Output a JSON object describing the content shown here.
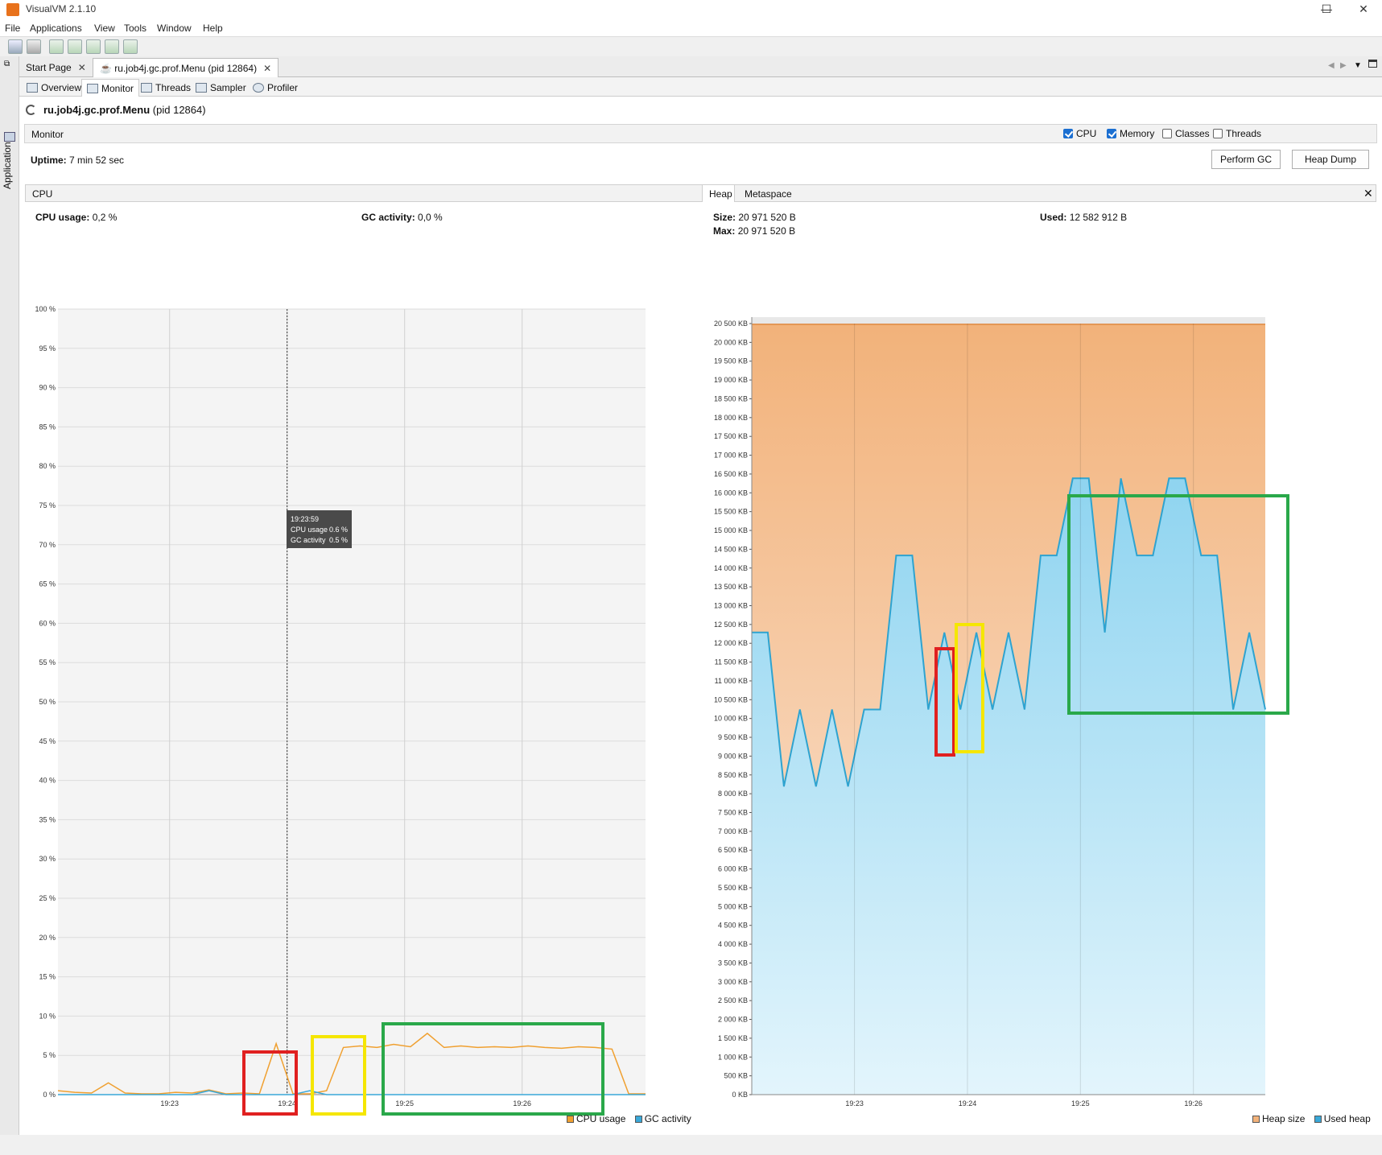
{
  "window": {
    "title": "VisualVM 2.1.10",
    "minimize": "—",
    "maximize": "☐",
    "close": "✕"
  },
  "menu": [
    "File",
    "Applications",
    "View",
    "Tools",
    "Window",
    "Help"
  ],
  "sidebar": {
    "label": "Applications"
  },
  "doc_tabs": [
    {
      "label": "Start Page"
    },
    {
      "label": "ru.job4j.gc.prof.Menu (pid 12864)"
    }
  ],
  "sub_tabs": [
    "Overview",
    "Monitor",
    "Threads",
    "Sampler",
    "Profiler"
  ],
  "process": {
    "name": "ru.job4j.gc.prof.Menu",
    "pid": "(pid 12864)"
  },
  "monitor": {
    "label": "Monitor",
    "checks": [
      {
        "label": "CPU",
        "checked": true
      },
      {
        "label": "Memory",
        "checked": true
      },
      {
        "label": "Classes",
        "checked": false
      },
      {
        "label": "Threads",
        "checked": false
      }
    ],
    "uptime_label": "Uptime:",
    "uptime_value": "7 min 52 sec",
    "perform_gc": "Perform GC",
    "heap_dump": "Heap Dump"
  },
  "cpu_panel": {
    "tab": "CPU",
    "cpu_usage_label": "CPU usage:",
    "cpu_usage_value": "0,2 %",
    "gc_activity_label": "GC activity:",
    "gc_activity_value": "0,0 %",
    "legend": [
      "CPU usage",
      "GC activity"
    ],
    "tooltip": {
      "time": "19:23:59",
      "cpu_label": "CPU usage",
      "cpu_value": "0.6 %",
      "gc_label": "GC activity",
      "gc_value": "0.5 %"
    }
  },
  "heap_panel": {
    "tabs": [
      "Heap",
      "Metaspace"
    ],
    "size_label": "Size:",
    "size_value": "20 971 520 B",
    "max_label": "Max:",
    "max_value": "20 971 520 B",
    "used_label": "Used:",
    "used_value": "12 582 912 B",
    "legend": [
      "Heap size",
      "Used heap"
    ]
  },
  "colors": {
    "cpu": "#f0a030",
    "gc": "#3aa8d8",
    "heap_size": "#f2b27a",
    "used_heap": "#8fd4f0",
    "used_line": "#2ea3d0",
    "red": "#e02020",
    "yellow": "#f5e600",
    "green": "#2aa84a"
  },
  "chart_data": [
    {
      "type": "line",
      "title": "CPU",
      "x": [
        "19:23",
        "19:24",
        "19:25",
        "19:26"
      ],
      "ylim": [
        0,
        100
      ],
      "yticks": [
        "0 %",
        "5 %",
        "10 %",
        "15 %",
        "20 %",
        "25 %",
        "30 %",
        "35 %",
        "40 %",
        "45 %",
        "50 %",
        "55 %",
        "60 %",
        "65 %",
        "70 %",
        "75 %",
        "80 %",
        "85 %",
        "90 %",
        "95 %",
        "100 %"
      ],
      "series": [
        {
          "name": "CPU usage",
          "values": [
            0.5,
            0.3,
            0.2,
            1.5,
            0.2,
            0.1,
            0.1,
            0.3,
            0.2,
            0.6,
            0.1,
            0.2,
            0.1,
            6.5,
            0.1,
            0.1,
            0.5,
            6.0,
            6.2,
            6.0,
            6.4,
            6.1,
            7.8,
            6.0,
            6.2,
            6.0,
            6.1,
            6.0,
            6.2,
            6.0,
            5.9,
            6.1,
            6.0,
            5.8,
            0.1,
            0.1
          ]
        },
        {
          "name": "GC activity",
          "values": [
            0,
            0,
            0,
            0,
            0,
            0,
            0,
            0,
            0,
            0.5,
            0,
            0,
            0,
            0,
            0,
            0.5,
            0,
            0,
            0,
            0,
            0,
            0,
            0,
            0,
            0,
            0,
            0,
            0,
            0,
            0,
            0,
            0,
            0,
            0,
            0,
            0
          ]
        }
      ]
    },
    {
      "type": "area",
      "title": "Heap",
      "x": [
        "19:23",
        "19:24",
        "19:25",
        "19:26"
      ],
      "ylim": [
        0,
        20500
      ],
      "yticks": [
        "0 KB",
        "500 KB",
        "1 000 KB",
        "1 500 KB",
        "2 000 KB",
        "2 500 KB",
        "3 000 KB",
        "3 500 KB",
        "4 000 KB",
        "4 500 KB",
        "5 000 KB",
        "5 500 KB",
        "6 000 KB",
        "6 500 KB",
        "7 000 KB",
        "7 500 KB",
        "8 000 KB",
        "8 500 KB",
        "9 000 KB",
        "9 500 KB",
        "10 000 KB",
        "10 500 KB",
        "11 000 KB",
        "11 500 KB",
        "12 000 KB",
        "12 500 KB",
        "13 000 KB",
        "13 500 KB",
        "14 000 KB",
        "14 500 KB",
        "15 000 KB",
        "15 500 KB",
        "16 000 KB",
        "16 500 KB",
        "17 000 KB",
        "17 500 KB",
        "18 000 KB",
        "18 500 KB",
        "19 000 KB",
        "19 500 KB",
        "20 000 KB",
        "20 500 KB"
      ],
      "series": [
        {
          "name": "Heap size",
          "values": [
            20480,
            20480
          ]
        },
        {
          "name": "Used heap",
          "values": [
            12288,
            12288,
            8192,
            10240,
            8192,
            10240,
            8192,
            10240,
            10240,
            14336,
            14336,
            10240,
            12288,
            10240,
            12288,
            10240,
            12288,
            10240,
            14336,
            14336,
            16384,
            16384,
            12288,
            16384,
            14336,
            14336,
            16384,
            16384,
            14336,
            14336,
            10240,
            12288,
            10240
          ]
        }
      ]
    }
  ]
}
